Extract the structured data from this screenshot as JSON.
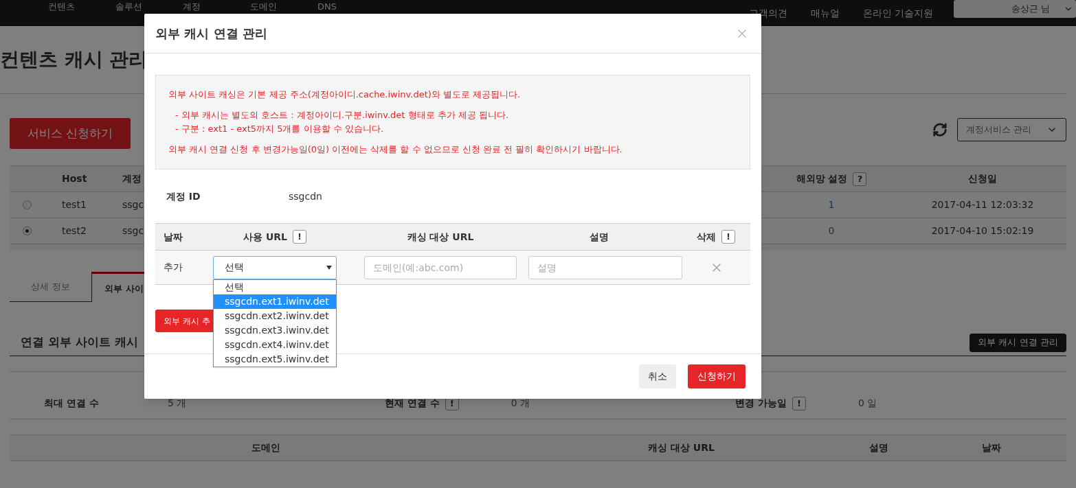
{
  "nav": {
    "left": [
      {
        "label": "컨텐츠"
      },
      {
        "label": "솔루션"
      },
      {
        "label": "계정"
      },
      {
        "label": "도메인"
      },
      {
        "label": "DNS"
      }
    ],
    "right": [
      {
        "label": "고객의견"
      },
      {
        "label": "매뉴얼"
      },
      {
        "label": "온라인 기술지원"
      }
    ],
    "user": "송상근 님"
  },
  "page": {
    "title": "컨텐츠 캐시 관리",
    "apply_button": "서비스 신청하기",
    "service_select": "계정서비스 관리",
    "table": {
      "columns": [
        {
          "label": "Host"
        },
        {
          "label": "계정"
        },
        {
          "label": "해외망 설정",
          "hint": "?"
        },
        {
          "label": "신청일"
        }
      ],
      "rows": [
        {
          "selected": false,
          "host": "test1",
          "account": "ssgc",
          "overseas": "1",
          "date": "2017-04-11 12:03:32"
        },
        {
          "selected": true,
          "host": "test2",
          "account": "ssgc",
          "overseas": "0",
          "date": "2017-04-10 15:02:19"
        }
      ]
    },
    "tabs": [
      {
        "label": "상세 정보",
        "selected": false
      },
      {
        "label": "외부 사이",
        "selected": true
      }
    ],
    "section_title": "연결 외부 사이트 캐시",
    "manage_button": "외부 캐시 연결 관리",
    "stats": [
      {
        "label": "최대 연결 수",
        "value": "5 개"
      },
      {
        "label": "현재 연결 수",
        "hint": "!",
        "value": "0 개"
      },
      {
        "label": "변경 가능일",
        "hint": "!",
        "value": "0 일"
      }
    ],
    "list_columns": [
      "도메인",
      "캐싱 대상 URL",
      "설명",
      "날짜"
    ]
  },
  "modal": {
    "title": "외부 캐시 연결 관리",
    "notice": [
      {
        "kind": "main",
        "text": "외부 사이트 캐싱은 기본 제공 주소(계정아이디.cache.iwinv.det)와 별도로 제공됩니다."
      },
      {
        "kind": "sub",
        "text": "- 외부 캐시는 별도의 호스트 : 계정아이디.구분.iwinv.det 형태로 추가 제공 됩니다."
      },
      {
        "kind": "sub",
        "text": "- 구분 : ext1 - ext5까지 5개를 이용할 수 있습니다."
      },
      {
        "kind": "main",
        "text": "외부 캐시 연결 신청 후 변경가능일(0일) 이전에는 삭제를 할 수 없으므로 신청 완료 전 필히 확인하시기 바랍니다."
      }
    ],
    "account": {
      "label": "계정 ID",
      "value": "ssgcdn"
    },
    "columns": [
      {
        "label": "날짜"
      },
      {
        "label": "사용 URL",
        "hint": "!"
      },
      {
        "label": "캐싱 대상 URL"
      },
      {
        "label": "설명"
      },
      {
        "label": "삭제",
        "hint": "!"
      }
    ],
    "add_row": {
      "label": "추가",
      "select_value": "선택",
      "expanded": true,
      "options": [
        {
          "label": "선택",
          "selected": false
        },
        {
          "label": "ssgcdn.ext1.iwinv.det",
          "selected": true
        },
        {
          "label": "ssgcdn.ext2.iwinv.det",
          "selected": false
        },
        {
          "label": "ssgcdn.ext3.iwinv.det",
          "selected": false
        },
        {
          "label": "ssgcdn.ext4.iwinv.det",
          "selected": false
        },
        {
          "label": "ssgcdn.ext5.iwinv.det",
          "selected": false
        }
      ],
      "domain_placeholder": "도메인(예:abc.com)",
      "desc_placeholder": "설명"
    },
    "add_button": "외부 캐시 추",
    "buttons": [
      {
        "kind": "cancel",
        "label": "취소"
      },
      {
        "kind": "submit",
        "label": "신청하기"
      }
    ]
  }
}
